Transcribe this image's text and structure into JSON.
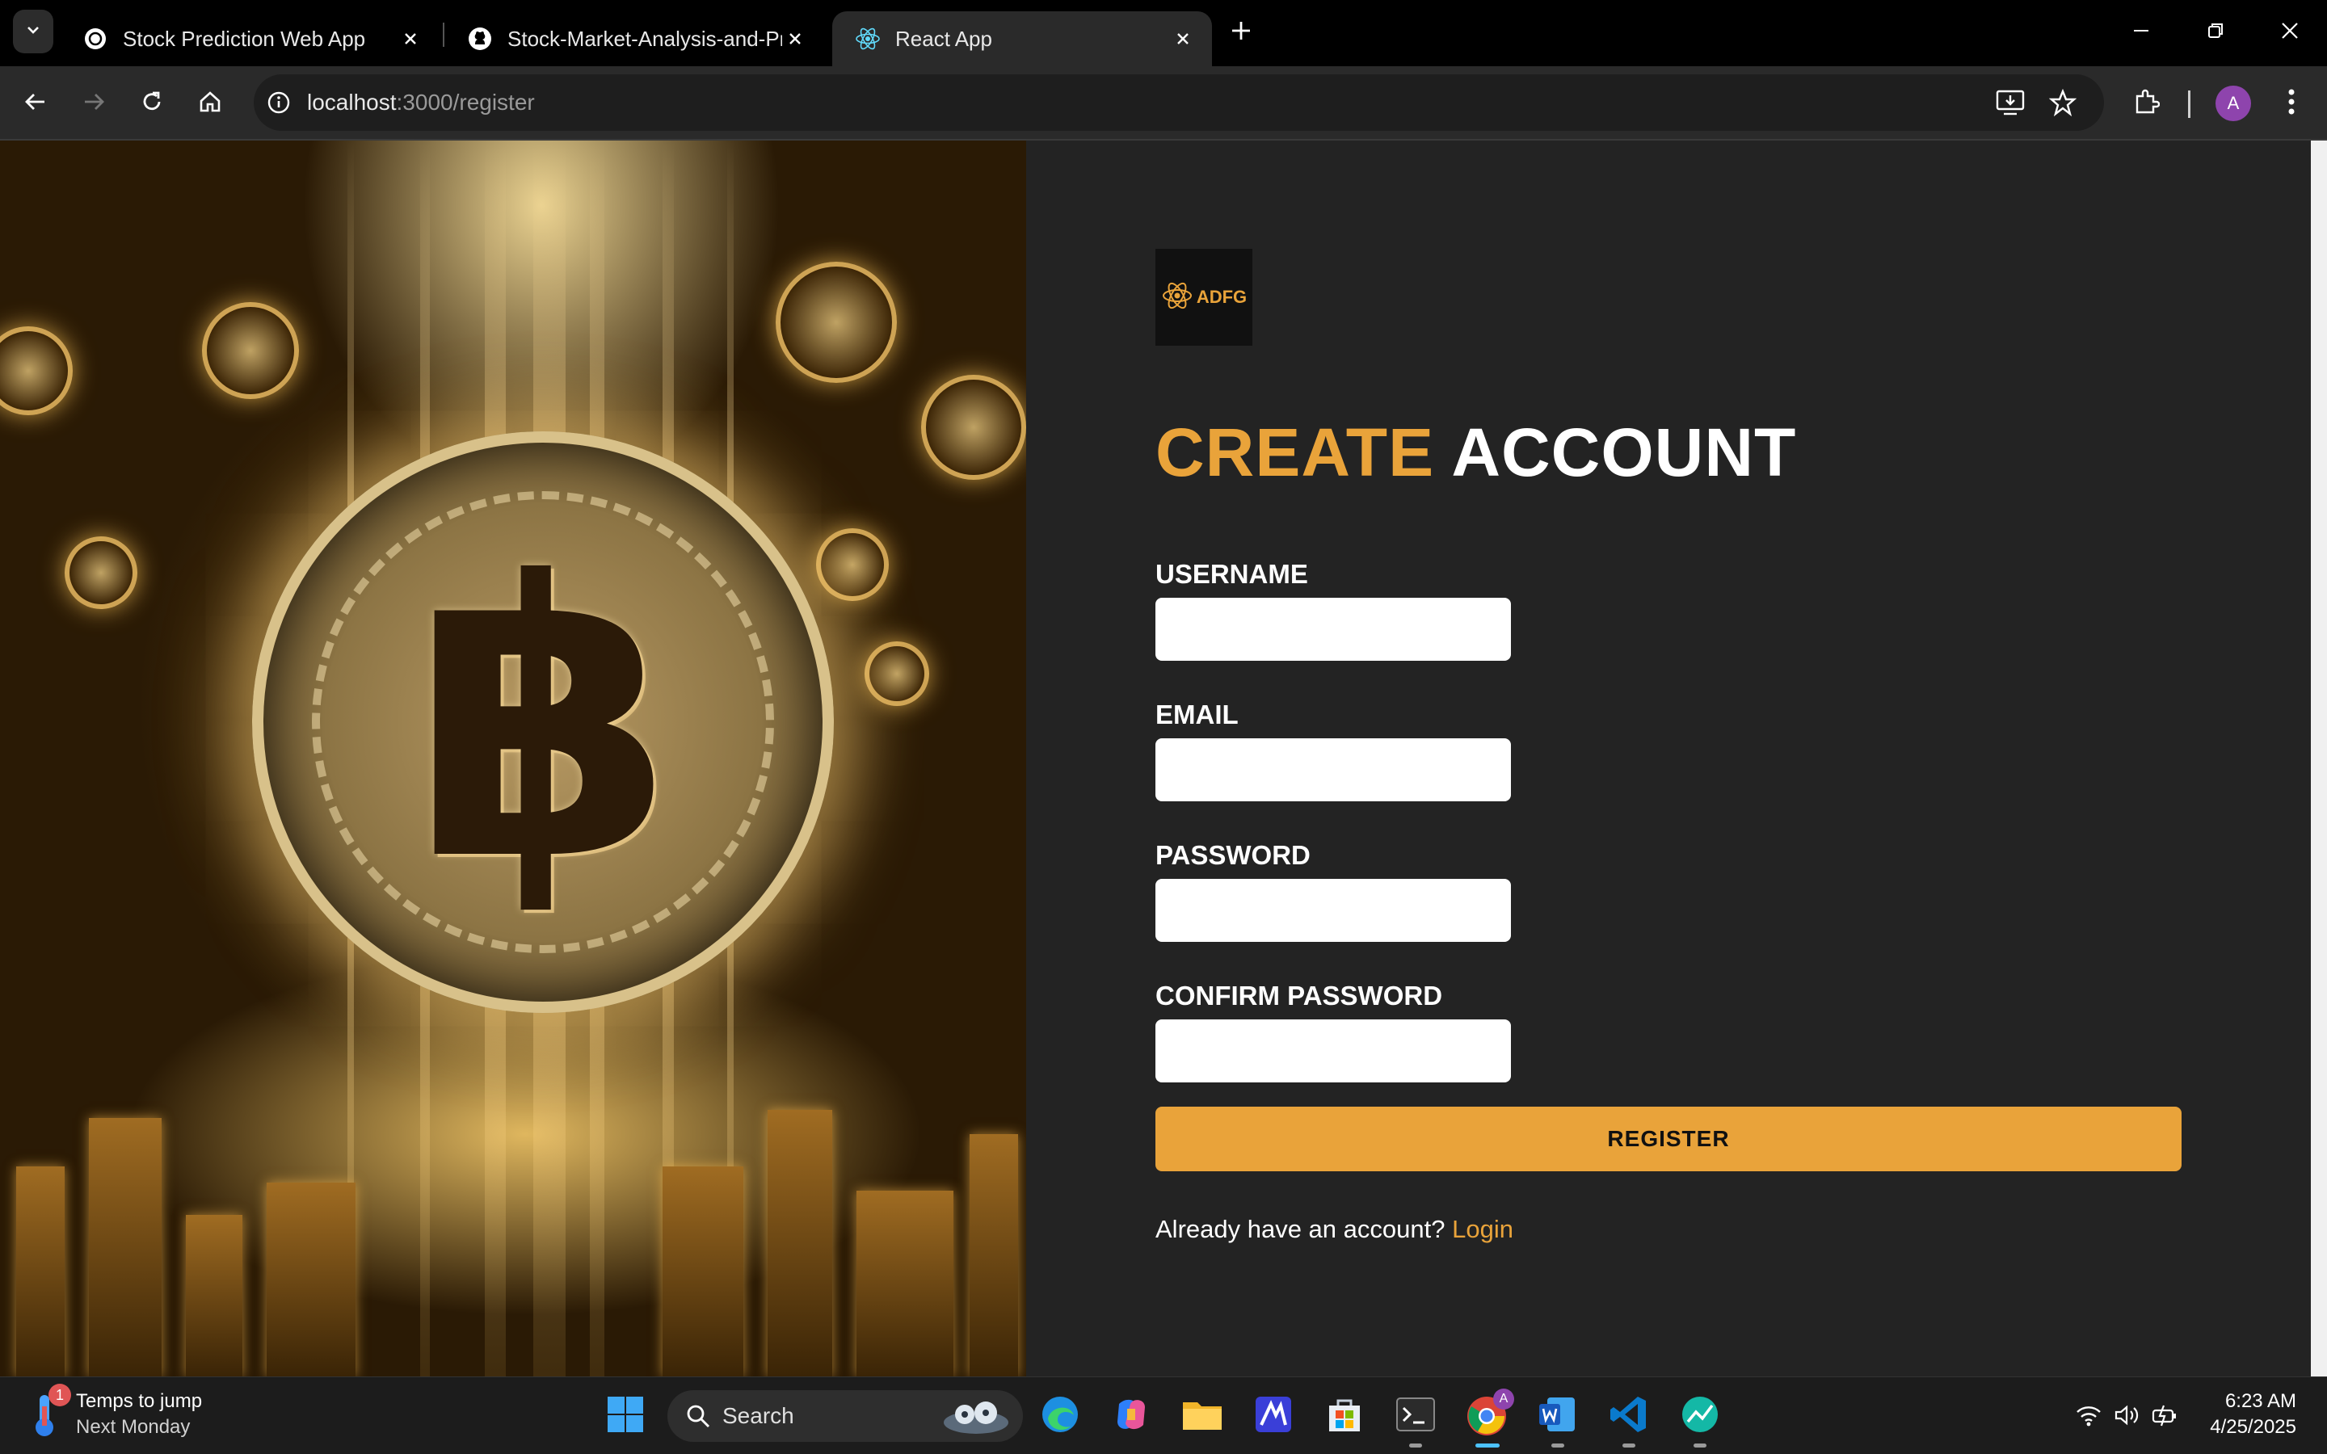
{
  "browser": {
    "tabs": [
      {
        "title": "Stock Prediction Web App",
        "icon": "openai-icon"
      },
      {
        "title": "Stock-Market-Analysis-and-Pre",
        "icon": "github-icon"
      },
      {
        "title": "React App",
        "icon": "react-icon",
        "active": true
      }
    ],
    "url_host": "localhost",
    "url_path": ":3000/register",
    "profile_initial": "A"
  },
  "page": {
    "logo_text": "ADFG",
    "heading_accent": "CREATE",
    "heading_rest": "ACCOUNT",
    "fields": {
      "username_label": "USERNAME",
      "email_label": "EMAIL",
      "password_label": "PASSWORD",
      "confirm_label": "CONFIRM PASSWORD"
    },
    "register_label": "REGISTER",
    "login_prompt": "Already have an account?",
    "login_link": "Login",
    "hero_symbol": "฿",
    "accent_color": "#e9a33a"
  },
  "taskbar": {
    "weather_title": "Temps to jump",
    "weather_sub": "Next Monday",
    "weather_badge": "1",
    "search_label": "Search",
    "time": "6:23 AM",
    "date": "4/25/2025",
    "chrome_badge": "A"
  }
}
